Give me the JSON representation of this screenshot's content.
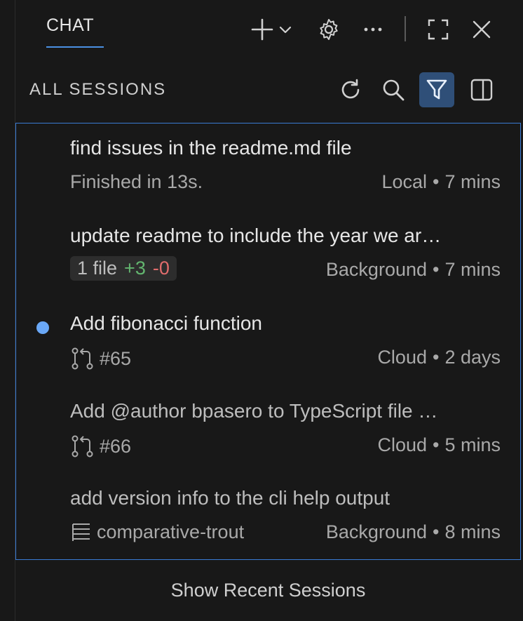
{
  "header": {
    "tab_label": "CHAT",
    "icons": [
      "add-icon",
      "chevron-down-icon",
      "gear-icon",
      "more-icon",
      "maximize-icon",
      "close-icon"
    ]
  },
  "sessions": {
    "title": "ALL SESSIONS",
    "icons": [
      "refresh-icon",
      "search-icon",
      "filter-icon",
      "split-panel-icon"
    ],
    "items": [
      {
        "title": "find issues in the readme.md file",
        "sub": "Finished in 13s.",
        "source": "Local",
        "time": "7 mins",
        "unread": false
      },
      {
        "title": "update readme to include the year we ar…",
        "files": "1 file",
        "plus": "+3",
        "minus": "-0",
        "source": "Background",
        "time": "7 mins",
        "unread": false
      },
      {
        "title": "Add fibonacci function",
        "pr": "#65",
        "source": "Cloud",
        "time": "2 days",
        "unread": true
      },
      {
        "title": "Add @author bpasero to TypeScript file …",
        "pr": "#66",
        "source": "Cloud",
        "time": "5 mins",
        "unread": false
      },
      {
        "title": "add version info to the cli help output",
        "worktree": "comparative-trout",
        "source": "Background",
        "time": "8 mins",
        "unread": false
      }
    ]
  },
  "footer": {
    "link": "Show Recent Sessions"
  },
  "colors": {
    "accent": "#3a7bd5",
    "unread_dot": "#6aa8f7",
    "added": "#63b56f",
    "removed": "#e06c6c"
  }
}
